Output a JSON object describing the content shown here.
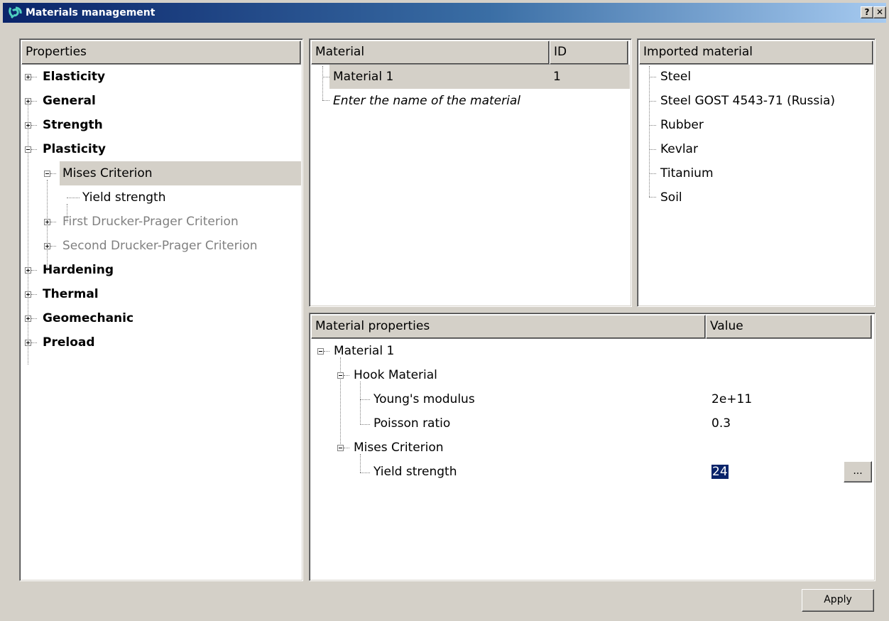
{
  "window": {
    "title": "Materials management",
    "help_label": "?",
    "close_label": "✕"
  },
  "properties_panel": {
    "header": "Properties",
    "items": [
      {
        "label": "Elasticity"
      },
      {
        "label": "General"
      },
      {
        "label": "Strength"
      },
      {
        "label": "Plasticity"
      },
      {
        "label": "Mises Criterion"
      },
      {
        "label": "Yield strength"
      },
      {
        "label": "First Drucker-Prager Criterion"
      },
      {
        "label": "Second Drucker-Prager Criterion"
      },
      {
        "label": "Hardening"
      },
      {
        "label": "Thermal"
      },
      {
        "label": "Geomechanic"
      },
      {
        "label": "Preload"
      }
    ]
  },
  "material_panel": {
    "headers": {
      "material": "Material",
      "id": "ID"
    },
    "rows": [
      {
        "name": "Material 1",
        "id": "1"
      }
    ],
    "new_row_placeholder": "Enter the name of the material"
  },
  "imported_panel": {
    "header": "Imported material",
    "items": [
      "Steel",
      "Steel GOST 4543-71 (Russia)",
      "Rubber",
      "Kevlar",
      "Titanium",
      "Soil"
    ]
  },
  "properties_table": {
    "headers": {
      "name": "Material properties",
      "value": "Value"
    },
    "root": "Material 1",
    "hook": {
      "label": "Hook Material",
      "youngs_label": "Young's modulus",
      "youngs_value": "2e+11",
      "poisson_label": "Poisson ratio",
      "poisson_value": "0.3"
    },
    "mises": {
      "label": "Mises Criterion",
      "yield_label": "Yield strength",
      "yield_value": "24"
    },
    "browse_button": "..."
  },
  "apply_button": "Apply"
}
